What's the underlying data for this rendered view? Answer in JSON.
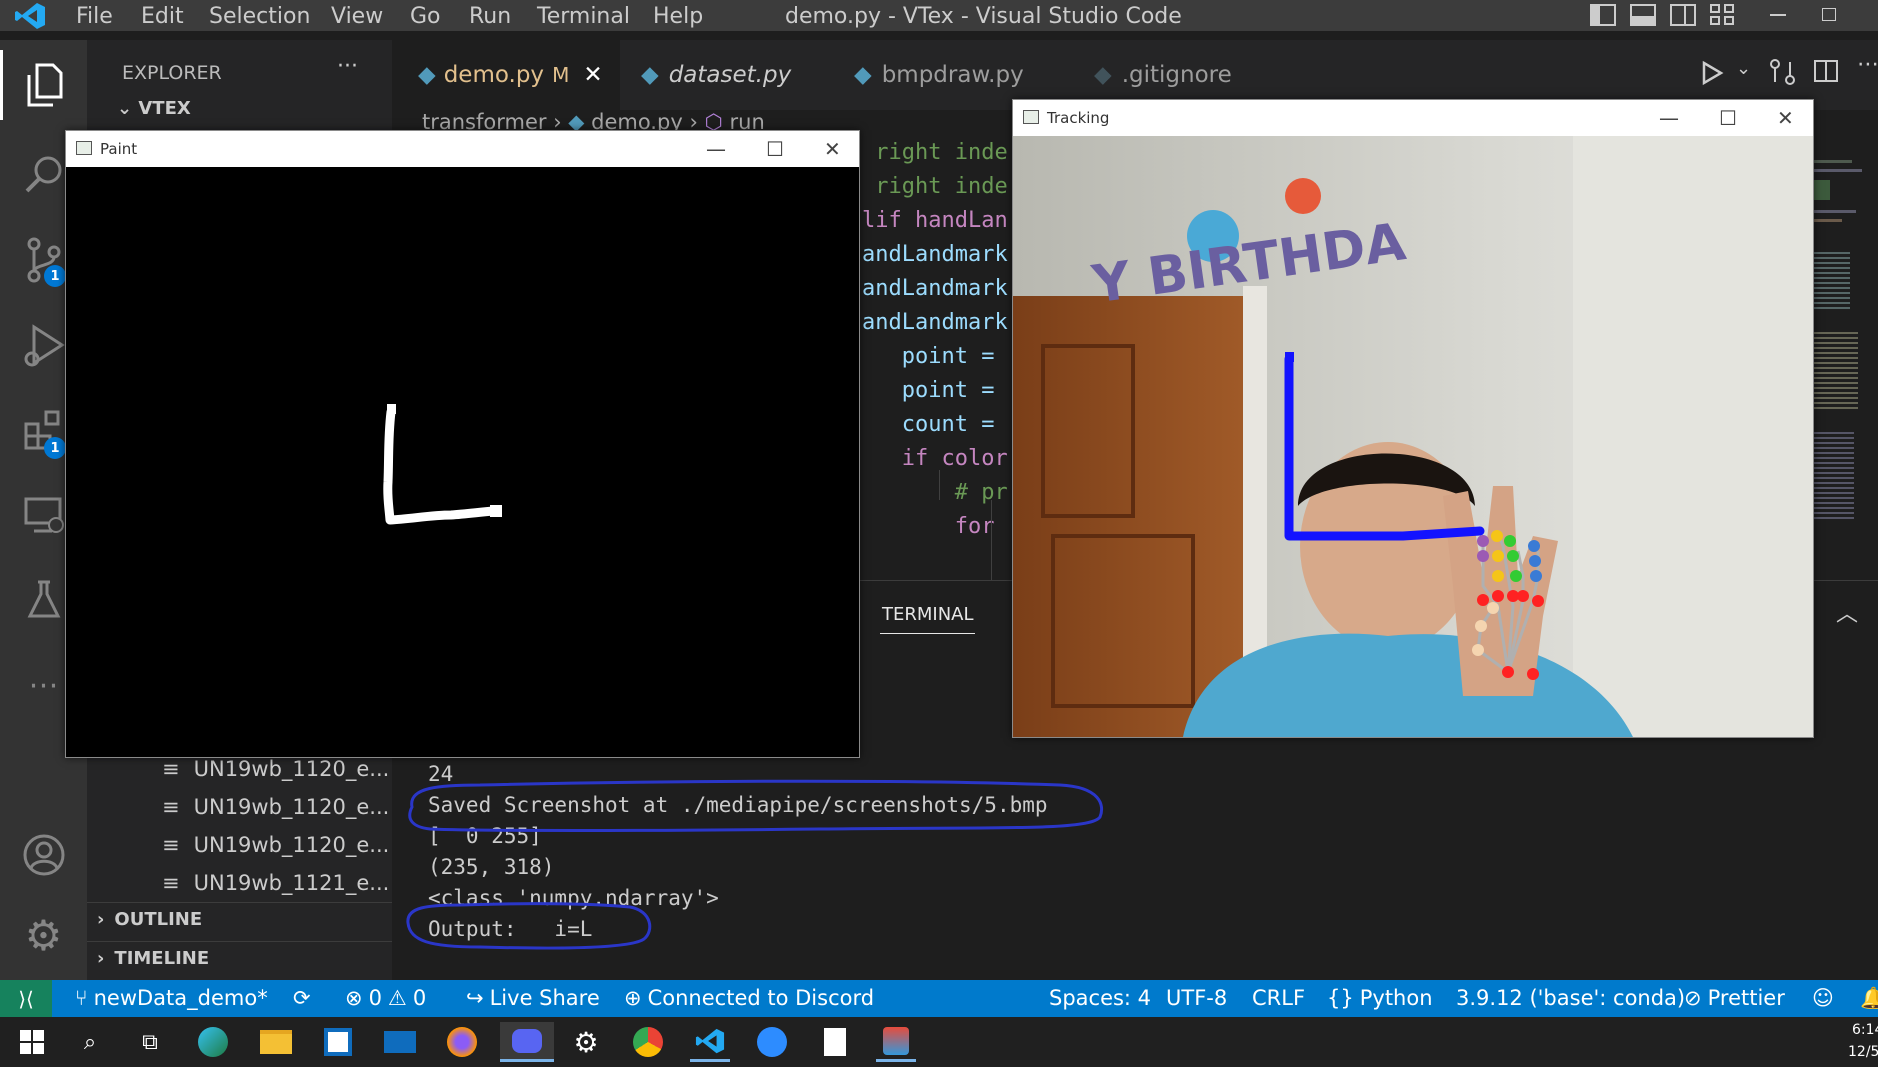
{
  "titlebar": {
    "menu": [
      "File",
      "Edit",
      "Selection",
      "View",
      "Go",
      "Run",
      "Terminal",
      "Help"
    ],
    "title": "demo.py - VTex - Visual Studio Code"
  },
  "activitybar": {
    "badges": {
      "source_control": "1",
      "extensions": "1"
    }
  },
  "sidebar": {
    "header": "EXPLORER",
    "more": "···",
    "root": "VTEX",
    "files": [
      "UN19wb_1120_e...",
      "UN19wb_1120_e...",
      "UN19wb_1120_e...",
      "UN19wb_1121_e..."
    ],
    "outline": "OUTLINE",
    "timeline": "TIMELINE"
  },
  "tabs": [
    {
      "label": "demo.py",
      "modifier": "M",
      "close": "✕"
    },
    {
      "label": "dataset.py"
    },
    {
      "label": "bmpdraw.py"
    },
    {
      "label": ".gitignore"
    }
  ],
  "breadcrumb": [
    "transformer",
    "demo.py",
    "run"
  ],
  "editor": {
    "lines": [
      {
        "text": " right inde",
        "color": "#6a9955"
      },
      {
        "text": " right inde",
        "color": "#6a9955"
      },
      {
        "text": "lif handLan",
        "color": "#c586c0"
      },
      {
        "text": "andLandmark",
        "color": "#9cdcfe"
      },
      {
        "text": "andLandmark",
        "color": "#9cdcfe"
      },
      {
        "text": "andLandmark",
        "color": "#9cdcfe"
      },
      {
        "text": "   point = ",
        "color": "#9cdcfe"
      },
      {
        "text": "   point = ",
        "color": "#9cdcfe"
      },
      {
        "text": "   count = ",
        "color": "#9cdcfe"
      },
      {
        "text": "   if color",
        "color": "#c586c0"
      },
      {
        "text": "       # pr",
        "color": "#6a9955"
      },
      {
        "text": "       for ",
        "color": "#c586c0"
      }
    ]
  },
  "panel": {
    "tab": "TERMINAL",
    "lines": [
      "24",
      "Saved Screenshot at ./mediapipe/screenshots/5.bmp",
      "[  0 255]",
      "(235, 318)",
      "<class 'numpy.ndarray'>",
      "Output:   i=L"
    ]
  },
  "paint_window": {
    "title": "Paint"
  },
  "tracking_window": {
    "title": "Tracking"
  },
  "statusbar": {
    "branch": "newData_demo*",
    "errors": "0",
    "warnings": "0",
    "live_share": "Live Share",
    "discord": "Connected to Discord",
    "spaces": "Spaces: 4",
    "encoding": "UTF-8",
    "eol": "CRLF",
    "language": "Python",
    "interpreter": "3.9.12 ('base': conda)",
    "prettier": "Prettier"
  },
  "taskbar": {
    "time": "6:14",
    "date": "12/5/"
  }
}
